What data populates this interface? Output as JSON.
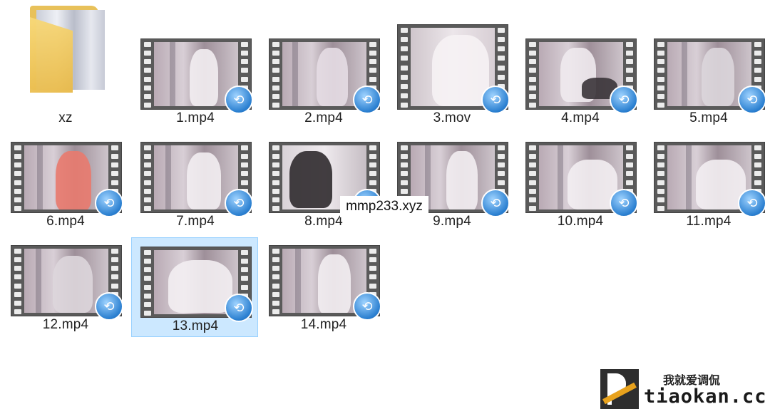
{
  "files": [
    {
      "name": "xz",
      "type": "folder",
      "selected": false
    },
    {
      "name": "1.mp4",
      "type": "video",
      "selected": false
    },
    {
      "name": "2.mp4",
      "type": "video",
      "selected": false
    },
    {
      "name": "3.mov",
      "type": "video",
      "selected": false
    },
    {
      "name": "4.mp4",
      "type": "video",
      "selected": false
    },
    {
      "name": "5.mp4",
      "type": "video",
      "selected": false
    },
    {
      "name": "6.mp4",
      "type": "video",
      "selected": false
    },
    {
      "name": "7.mp4",
      "type": "video",
      "selected": false
    },
    {
      "name": "8.mp4",
      "type": "video",
      "selected": false
    },
    {
      "name": "9.mp4",
      "type": "video",
      "selected": false
    },
    {
      "name": "10.mp4",
      "type": "video",
      "selected": false
    },
    {
      "name": "11.mp4",
      "type": "video",
      "selected": false
    },
    {
      "name": "12.mp4",
      "type": "video",
      "selected": false
    },
    {
      "name": "13.mp4",
      "type": "video",
      "selected": true
    },
    {
      "name": "14.mp4",
      "type": "video",
      "selected": false
    }
  ],
  "overlay_text": "mmp233.xyz",
  "watermark": {
    "chinese": "我就爱调侃",
    "site": "tiaokan.cc"
  },
  "colors": {
    "selection_bg": "#cce8ff",
    "selection_border": "#99d1ff",
    "folder": "#e8c15a",
    "player_badge": "#2a7fd0"
  }
}
